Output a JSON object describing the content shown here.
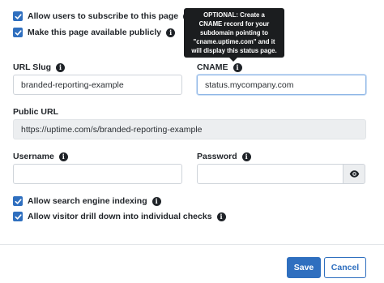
{
  "checkboxes_top": [
    {
      "label": "Allow users to subscribe to this page",
      "checked": true
    },
    {
      "label": "Make this page available publicly",
      "checked": true
    }
  ],
  "tooltip": {
    "lines": [
      "OPTIONAL: Create a",
      "CNAME record for your",
      "subdomain pointing to",
      "\"cname.uptime.com\" and it",
      "will display this status page."
    ]
  },
  "url_slug": {
    "label": "URL Slug",
    "value": "branded-reporting-example"
  },
  "cname": {
    "label": "CNAME",
    "value": "status.mycompany.com"
  },
  "public_url": {
    "label": "Public URL",
    "value": "https://uptime.com/s/branded-reporting-example"
  },
  "username": {
    "label": "Username",
    "value": ""
  },
  "password": {
    "label": "Password",
    "value": ""
  },
  "checkboxes_bottom": [
    {
      "label": "Allow search engine indexing",
      "checked": true
    },
    {
      "label": "Allow visitor drill down into individual checks",
      "checked": true
    }
  ],
  "buttons": {
    "save": "Save",
    "cancel": "Cancel"
  },
  "icons": {
    "info": "info-icon",
    "eye": "eye-icon",
    "check": "checkmark-icon"
  },
  "colors": {
    "accent": "#2f6fbf",
    "tooltip_bg": "#1b1d1f",
    "readonly_bg": "#eceef0"
  }
}
